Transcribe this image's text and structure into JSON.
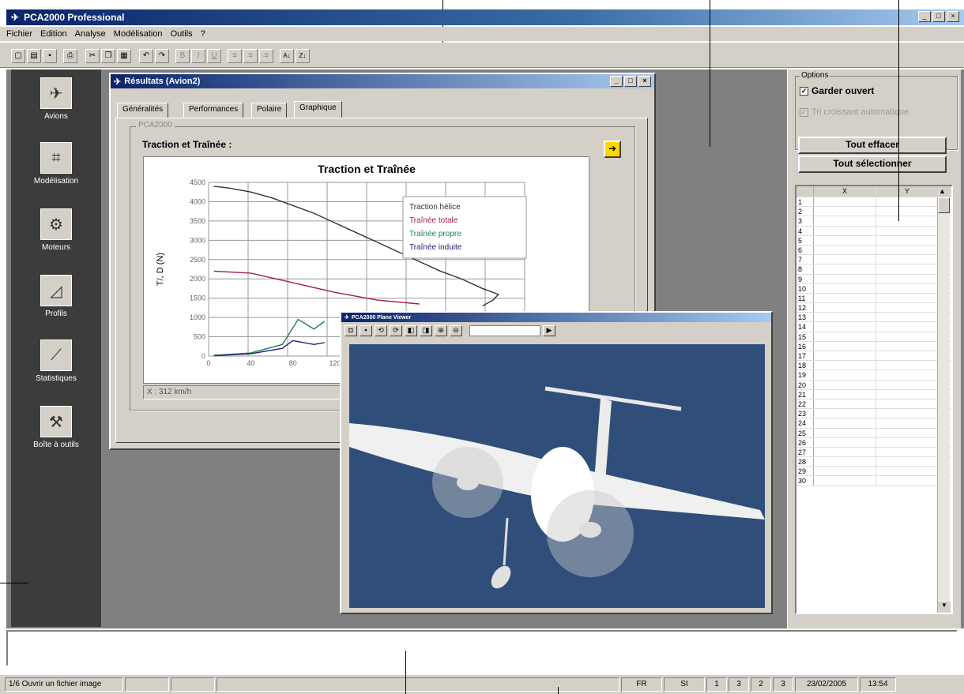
{
  "app": {
    "title": "PCA2000 Professional",
    "window_buttons": [
      "_",
      "□",
      "×"
    ]
  },
  "menu": [
    "Fichier",
    "Edition",
    "Analyse",
    "Modélisation",
    "Outils",
    "?"
  ],
  "toolbar": {
    "icons": [
      "new-icon",
      "open-icon",
      "save-icon",
      "print-icon",
      "cut-icon",
      "copy-icon",
      "paste-icon",
      "undo-icon",
      "redo-icon",
      "bold-icon",
      "italic-icon",
      "underline-icon",
      "align-left-icon",
      "align-center-icon",
      "align-right-icon",
      "sort-asc-icon",
      "sort-desc-icon"
    ],
    "bold": "B",
    "italic": "I",
    "underline": "U"
  },
  "sidebar": {
    "items": [
      {
        "label": "Avions",
        "icon": "airplane-icon"
      },
      {
        "label": "Modélisation",
        "icon": "modeling-icon"
      },
      {
        "label": "Moteurs",
        "icon": "engine-icon"
      },
      {
        "label": "Profils",
        "icon": "profile-icon"
      },
      {
        "label": "Statistiques",
        "icon": "statistics-icon"
      },
      {
        "label": "Boîte à outils",
        "icon": "toolbox-icon"
      }
    ]
  },
  "results": {
    "title": "Résultats (Avion2)",
    "tabs": [
      "Généralités",
      "Performances",
      "Polaire",
      "Graphique"
    ],
    "group": "PCA2000",
    "subtitle": "Traction et Traînée :",
    "readout": "X : 312 km/h"
  },
  "viewer": {
    "title": "PCA2000 Plane Viewer"
  },
  "options": {
    "group": "Options",
    "keep_open": "Garder ouvert",
    "auto_sort": "Tri croissant automatique",
    "clear_all": "Tout effacer",
    "select_all": "Tout sélectionner"
  },
  "grid": {
    "col_x": "X",
    "col_y": "Y",
    "rows": [
      "1",
      "2",
      "3",
      "4",
      "5",
      "6",
      "7",
      "8",
      "9",
      "10",
      "11",
      "12",
      "13",
      "14",
      "15",
      "16",
      "17",
      "18",
      "19",
      "20",
      "21",
      "22",
      "23",
      "24",
      "25",
      "26",
      "27",
      "28",
      "29",
      "30"
    ]
  },
  "status": {
    "message": "1/6 Ouvrir un fichier image",
    "lang": "FR",
    "units": "SI",
    "n1": "1",
    "n2": "3",
    "n3": "2",
    "n4": "3",
    "date": "23/02/2005",
    "time": "13:54"
  },
  "chart_data": {
    "type": "line",
    "title": "Traction et Traînée",
    "ylabel": "T/, D (N)",
    "xlabel": "",
    "ylim": [
      0,
      4500
    ],
    "yticks": [
      0,
      500,
      1000,
      1500,
      2000,
      2500,
      3000,
      3500,
      4000,
      4500
    ],
    "xticks": [
      0,
      40,
      80,
      120
    ],
    "xlim": [
      0,
      300
    ],
    "legend_position": "top-right",
    "series": [
      {
        "name": "Traction hélice",
        "color": "#333333",
        "x": [
          5,
          20,
          40,
          60,
          80,
          100,
          120,
          140,
          160,
          180,
          200,
          220,
          240,
          260,
          275,
          270,
          260
        ],
        "y": [
          4400,
          4350,
          4250,
          4100,
          3900,
          3700,
          3450,
          3200,
          2950,
          2700,
          2450,
          2200,
          2000,
          1750,
          1600,
          1450,
          1300
        ]
      },
      {
        "name": "Traînée totale",
        "color": "#a0204a",
        "x": [
          5,
          40,
          80,
          120,
          160,
          200
        ],
        "y": [
          2200,
          2150,
          1900,
          1650,
          1450,
          1350
        ]
      },
      {
        "name": "Traînée propre",
        "color": "#208050",
        "x": [
          5,
          40,
          70,
          85,
          100,
          110
        ],
        "y": [
          20,
          80,
          300,
          950,
          700,
          900
        ]
      },
      {
        "name": "Traînée induite",
        "color": "#202080",
        "x": [
          5,
          40,
          70,
          80,
          100,
          110
        ],
        "y": [
          10,
          60,
          200,
          400,
          300,
          350
        ]
      }
    ]
  }
}
